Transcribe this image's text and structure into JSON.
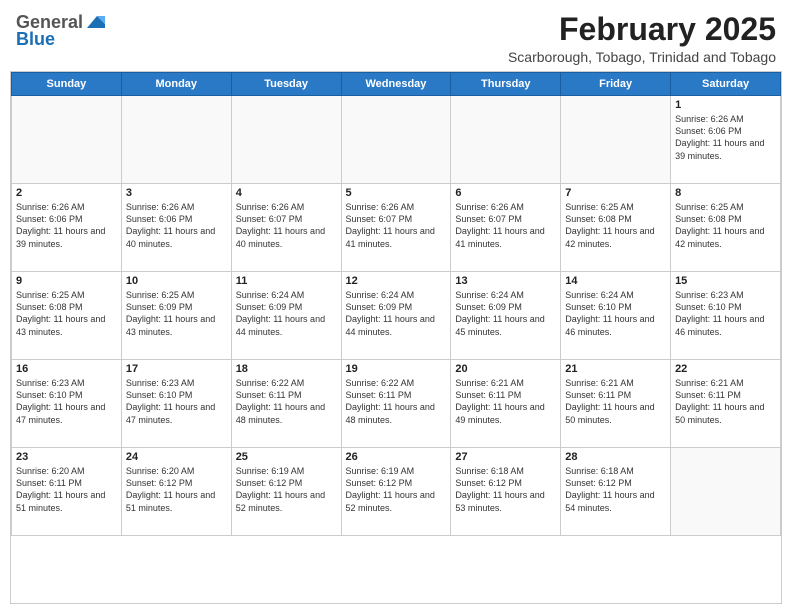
{
  "header": {
    "logo_general": "General",
    "logo_blue": "Blue",
    "month_title": "February 2025",
    "subtitle": "Scarborough, Tobago, Trinidad and Tobago"
  },
  "days_of_week": [
    "Sunday",
    "Monday",
    "Tuesday",
    "Wednesday",
    "Thursday",
    "Friday",
    "Saturday"
  ],
  "weeks": [
    [
      {
        "day": "",
        "text": ""
      },
      {
        "day": "",
        "text": ""
      },
      {
        "day": "",
        "text": ""
      },
      {
        "day": "",
        "text": ""
      },
      {
        "day": "",
        "text": ""
      },
      {
        "day": "",
        "text": ""
      },
      {
        "day": "1",
        "text": "Sunrise: 6:26 AM\nSunset: 6:06 PM\nDaylight: 11 hours and 39 minutes."
      }
    ],
    [
      {
        "day": "2",
        "text": "Sunrise: 6:26 AM\nSunset: 6:06 PM\nDaylight: 11 hours and 39 minutes."
      },
      {
        "day": "3",
        "text": "Sunrise: 6:26 AM\nSunset: 6:06 PM\nDaylight: 11 hours and 40 minutes."
      },
      {
        "day": "4",
        "text": "Sunrise: 6:26 AM\nSunset: 6:07 PM\nDaylight: 11 hours and 40 minutes."
      },
      {
        "day": "5",
        "text": "Sunrise: 6:26 AM\nSunset: 6:07 PM\nDaylight: 11 hours and 41 minutes."
      },
      {
        "day": "6",
        "text": "Sunrise: 6:26 AM\nSunset: 6:07 PM\nDaylight: 11 hours and 41 minutes."
      },
      {
        "day": "7",
        "text": "Sunrise: 6:25 AM\nSunset: 6:08 PM\nDaylight: 11 hours and 42 minutes."
      },
      {
        "day": "8",
        "text": "Sunrise: 6:25 AM\nSunset: 6:08 PM\nDaylight: 11 hours and 42 minutes."
      }
    ],
    [
      {
        "day": "9",
        "text": "Sunrise: 6:25 AM\nSunset: 6:08 PM\nDaylight: 11 hours and 43 minutes."
      },
      {
        "day": "10",
        "text": "Sunrise: 6:25 AM\nSunset: 6:09 PM\nDaylight: 11 hours and 43 minutes."
      },
      {
        "day": "11",
        "text": "Sunrise: 6:24 AM\nSunset: 6:09 PM\nDaylight: 11 hours and 44 minutes."
      },
      {
        "day": "12",
        "text": "Sunrise: 6:24 AM\nSunset: 6:09 PM\nDaylight: 11 hours and 44 minutes."
      },
      {
        "day": "13",
        "text": "Sunrise: 6:24 AM\nSunset: 6:09 PM\nDaylight: 11 hours and 45 minutes."
      },
      {
        "day": "14",
        "text": "Sunrise: 6:24 AM\nSunset: 6:10 PM\nDaylight: 11 hours and 46 minutes."
      },
      {
        "day": "15",
        "text": "Sunrise: 6:23 AM\nSunset: 6:10 PM\nDaylight: 11 hours and 46 minutes."
      }
    ],
    [
      {
        "day": "16",
        "text": "Sunrise: 6:23 AM\nSunset: 6:10 PM\nDaylight: 11 hours and 47 minutes."
      },
      {
        "day": "17",
        "text": "Sunrise: 6:23 AM\nSunset: 6:10 PM\nDaylight: 11 hours and 47 minutes."
      },
      {
        "day": "18",
        "text": "Sunrise: 6:22 AM\nSunset: 6:11 PM\nDaylight: 11 hours and 48 minutes."
      },
      {
        "day": "19",
        "text": "Sunrise: 6:22 AM\nSunset: 6:11 PM\nDaylight: 11 hours and 48 minutes."
      },
      {
        "day": "20",
        "text": "Sunrise: 6:21 AM\nSunset: 6:11 PM\nDaylight: 11 hours and 49 minutes."
      },
      {
        "day": "21",
        "text": "Sunrise: 6:21 AM\nSunset: 6:11 PM\nDaylight: 11 hours and 50 minutes."
      },
      {
        "day": "22",
        "text": "Sunrise: 6:21 AM\nSunset: 6:11 PM\nDaylight: 11 hours and 50 minutes."
      }
    ],
    [
      {
        "day": "23",
        "text": "Sunrise: 6:20 AM\nSunset: 6:11 PM\nDaylight: 11 hours and 51 minutes."
      },
      {
        "day": "24",
        "text": "Sunrise: 6:20 AM\nSunset: 6:12 PM\nDaylight: 11 hours and 51 minutes."
      },
      {
        "day": "25",
        "text": "Sunrise: 6:19 AM\nSunset: 6:12 PM\nDaylight: 11 hours and 52 minutes."
      },
      {
        "day": "26",
        "text": "Sunrise: 6:19 AM\nSunset: 6:12 PM\nDaylight: 11 hours and 52 minutes."
      },
      {
        "day": "27",
        "text": "Sunrise: 6:18 AM\nSunset: 6:12 PM\nDaylight: 11 hours and 53 minutes."
      },
      {
        "day": "28",
        "text": "Sunrise: 6:18 AM\nSunset: 6:12 PM\nDaylight: 11 hours and 54 minutes."
      },
      {
        "day": "",
        "text": ""
      }
    ]
  ]
}
